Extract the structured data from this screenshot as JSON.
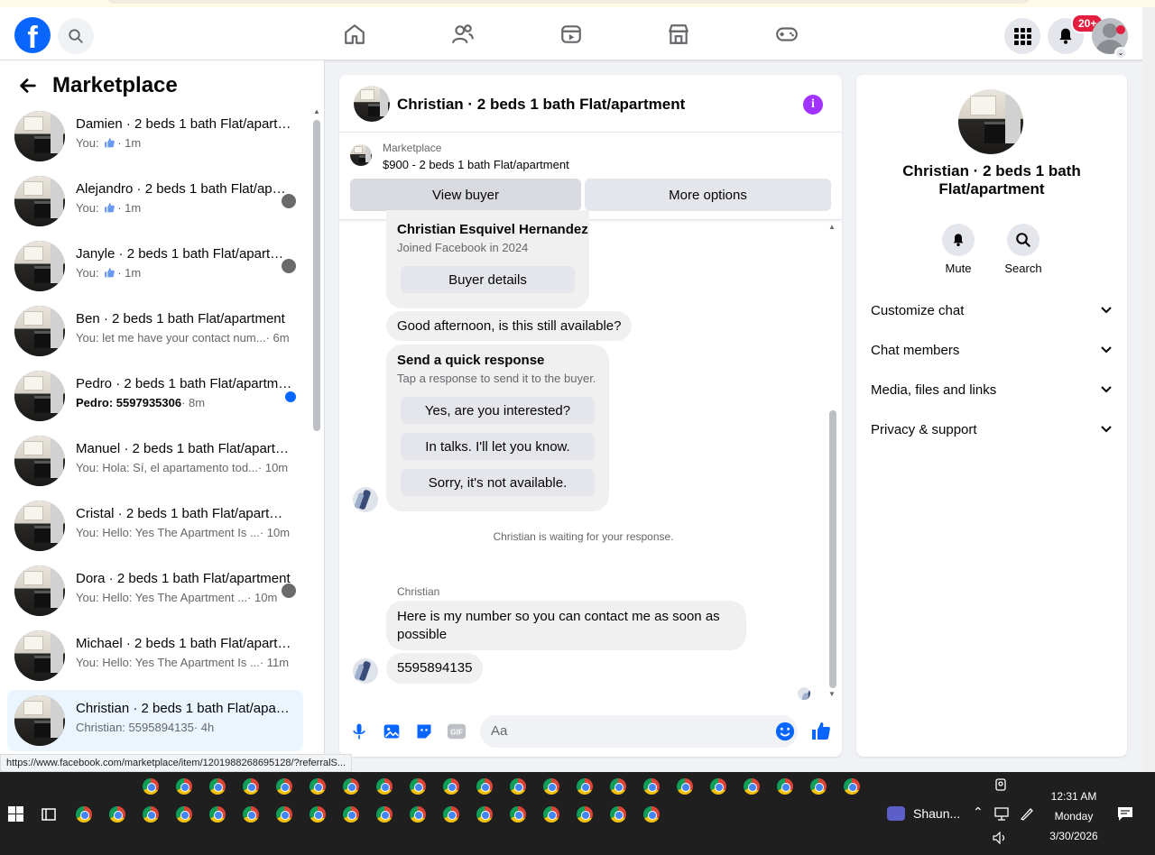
{
  "topbar": {
    "logo": "f",
    "notification_count": "20+",
    "nav_icons": [
      "home-icon",
      "friends-icon",
      "video-icon",
      "marketplace-icon",
      "gaming-icon"
    ]
  },
  "sidebar": {
    "title": "Marketplace",
    "conversations": [
      {
        "name": "Damien · 2 beds 1 bath Flat/apartment",
        "prefix": "You:",
        "preview": "",
        "time": "· 1m",
        "liked": true
      },
      {
        "name": "Alejandro · 2 beds 1 bath Flat/apartment",
        "prefix": "You:",
        "preview": "",
        "time": "· 1m",
        "liked": true
      },
      {
        "name": "Janyle · 2 beds 1 bath Flat/apartment",
        "prefix": "You:",
        "preview": "",
        "time": "· 1m",
        "liked": true
      },
      {
        "name": "Ben · 2 beds 1 bath Flat/apartment",
        "prefix": "You:",
        "preview": "let me have your contact num...",
        "time": "· 6m"
      },
      {
        "name": "Pedro · 2 beds 1 bath Flat/apartment",
        "prefix": "Pedro:",
        "preview": "5597935306",
        "time": "· 8m",
        "unread": true
      },
      {
        "name": "Manuel · 2 beds 1 bath Flat/apartment",
        "prefix": "You:",
        "preview": "Hola: Sí, el apartamento tod...",
        "time": "· 10m"
      },
      {
        "name": "Cristal · 2 beds 1 bath Flat/apartment",
        "prefix": "You:",
        "preview": "Hello: Yes The Apartment Is ...",
        "time": "· 10m"
      },
      {
        "name": "Dora · 2 beds 1 bath Flat/apartment",
        "prefix": "You:",
        "preview": "Hello: Yes The Apartment ...",
        "time": "· 10m"
      },
      {
        "name": "Michael · 2 beds 1 bath Flat/apartment",
        "prefix": "You:",
        "preview": "Hello: Yes The Apartment Is ...",
        "time": "· 11m"
      },
      {
        "name": "Christian · 2 beds 1 bath Flat/apartment",
        "prefix": "Christian:",
        "preview": "5595894135",
        "time": "· 4h",
        "active": true
      }
    ]
  },
  "chat": {
    "title": "Christian · 2 beds 1 bath Flat/apartment",
    "marketplace_label": "Marketplace",
    "listing": "$900 - 2 beds 1 bath Flat/apartment",
    "view_buyer": "View buyer",
    "more_options": "More options",
    "buyer_name": "Christian Esquivel Hernandez",
    "buyer_joined": "Joined Facebook in 2024",
    "buyer_details": "Buyer details",
    "msg1": "Good afternoon, is this still available?",
    "quick_title": "Send a quick response",
    "quick_sub": "Tap a response to send it to the buyer.",
    "quick1": "Yes, are you interested?",
    "quick2": "In talks. I'll let you know.",
    "quick3": "Sorry, it's not available.",
    "waiting": "Christian is waiting for your response.",
    "sender": "Christian",
    "msg2": "Here is my number so you can contact me as soon as possible",
    "msg3": "5595894135",
    "input_placeholder": "Aa"
  },
  "rpanel": {
    "title": "Christian · 2 beds 1 bath Flat/apartment",
    "mute": "Mute",
    "search": "Search",
    "rows": [
      "Customize chat",
      "Chat members",
      "Media, files and links",
      "Privacy & support"
    ]
  },
  "status_url": "https://www.facebook.com/marketplace/item/1201988268695128/?referralS...",
  "taskbar": {
    "app_label": "Shaun...",
    "time": "12:31 AM",
    "day": "Monday",
    "date": "3/30/2026"
  },
  "colors": {
    "brand": "#0866ff",
    "info": "#a033ff",
    "badge": "#e41e3f"
  }
}
